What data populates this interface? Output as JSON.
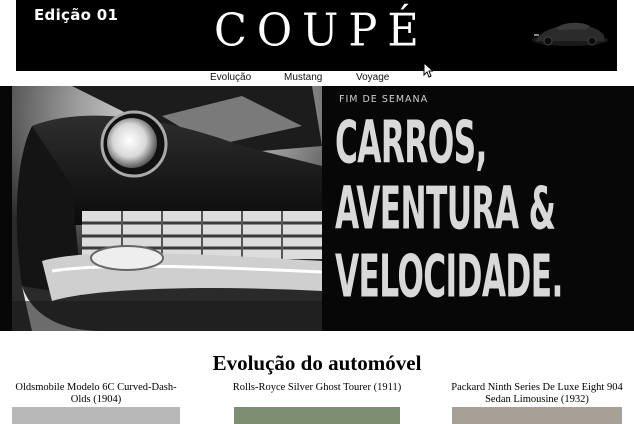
{
  "header": {
    "edition": "Edição 01",
    "logo": "COUPÉ"
  },
  "nav": {
    "items": [
      {
        "label": "Evolução"
      },
      {
        "label": "Mustang"
      },
      {
        "label": "Voyage"
      }
    ]
  },
  "hero": {
    "kicker": "FIM DE SEMANA",
    "lines": [
      "CARROS,",
      "AVENTURA &",
      "VELOCIDADE."
    ]
  },
  "section": {
    "title": "Evolução do automóvel",
    "cards": [
      {
        "title": "Oldsmobile Modelo 6C Curved-Dash-Olds (1904)"
      },
      {
        "title": "Rolls-Royce Silver Ghost Tourer (1911)"
      },
      {
        "title": "Packard Ninth Series De Luxe Eight 904 Sedan Limousine (1932)"
      }
    ]
  },
  "colors": {
    "header_bg": "#000000",
    "hero_bg": "#070707",
    "hero_text": "#d9d9d9"
  }
}
